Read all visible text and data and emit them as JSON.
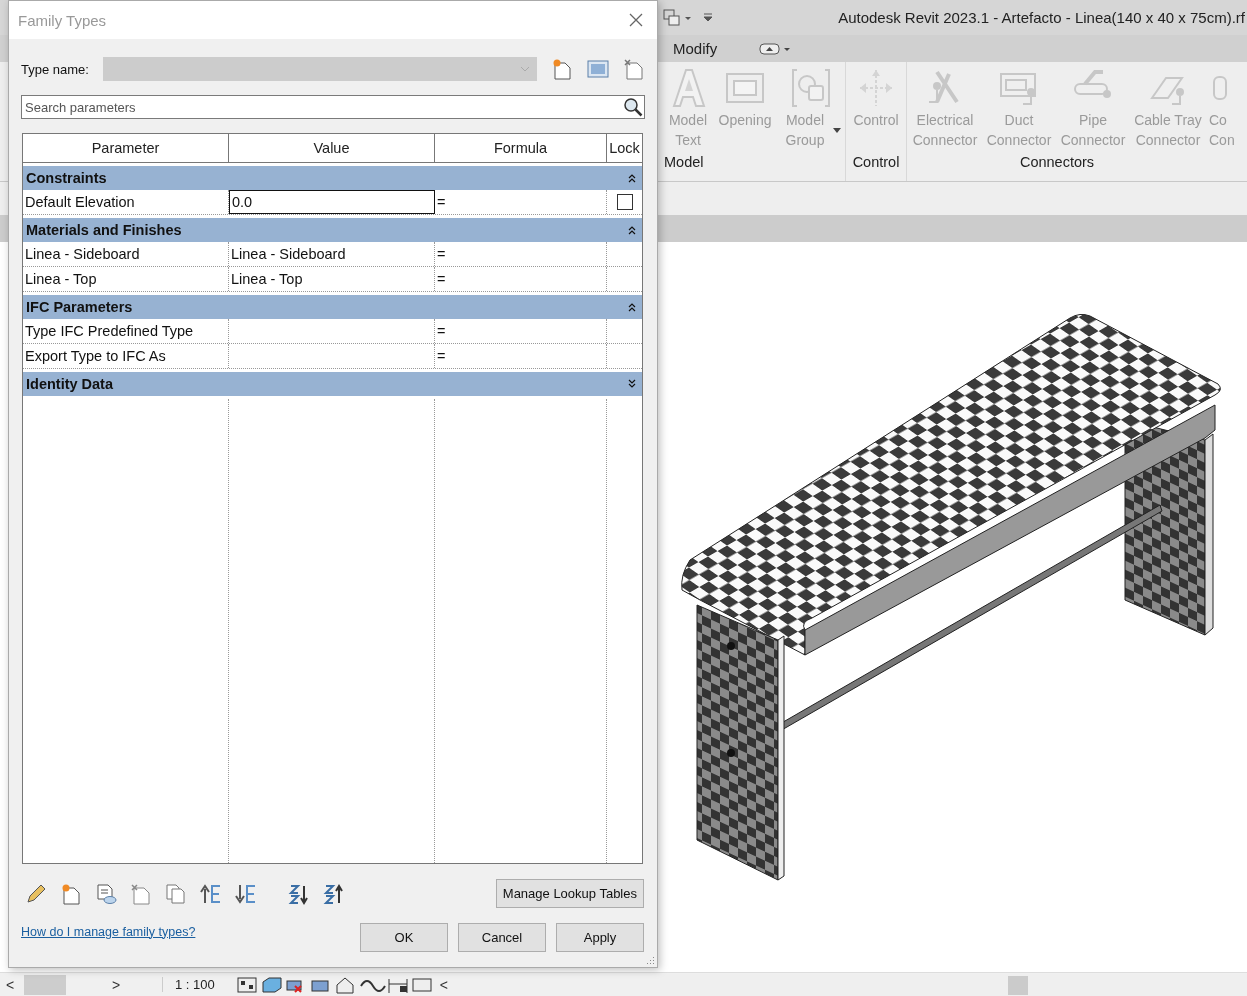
{
  "app": {
    "title": "Autodesk Revit 2023.1 - Artefacto - Linea(140 x 40 x 75cm).rf",
    "ribbon_tab": "Modify",
    "ribbon_panels": [
      {
        "label": "Model",
        "tools": [
          {
            "kind": "text",
            "label": "Model Text",
            "disabled": true
          },
          {
            "kind": "opening",
            "label": "Opening",
            "disabled": true
          },
          {
            "kind": "group",
            "label": "Model Group",
            "disabled": true
          }
        ]
      },
      {
        "label": "Control",
        "tools": [
          {
            "kind": "control",
            "label": "Control",
            "disabled": true
          }
        ]
      },
      {
        "label": "Connectors",
        "tools": [
          {
            "kind": "electrical",
            "label": "Electrical Connector",
            "disabled": true
          },
          {
            "kind": "duct",
            "label": "Duct Connector",
            "disabled": true
          },
          {
            "kind": "pipe",
            "label": "Pipe Connector",
            "disabled": true
          },
          {
            "kind": "cable_tray",
            "label": "Cable Tray Connector",
            "disabled": true
          },
          {
            "kind": "conduit",
            "label": "Co Con",
            "disabled": true
          }
        ]
      }
    ],
    "status_bar": {
      "scroll_left": "<",
      "scroll_right": ">",
      "scale": "1 : 100",
      "collapse": "<"
    }
  },
  "dialog": {
    "title": "Family Types",
    "type_name": {
      "label": "Type name:",
      "disabled": true
    },
    "search": {
      "placeholder": "Search parameters"
    },
    "columns": [
      "Parameter",
      "Value",
      "Formula",
      "Lock"
    ],
    "groups": [
      {
        "name": "Constraints",
        "expanded": true,
        "rows": [
          {
            "parameter": "Default Elevation",
            "value": "0.0",
            "formula": "=",
            "selected": true,
            "lock": false
          }
        ]
      },
      {
        "name": "Materials and Finishes",
        "expanded": true,
        "rows": [
          {
            "parameter": "Linea - Sideboard",
            "value": "Linea - Sideboard",
            "formula": "=",
            "selected": false
          },
          {
            "parameter": "Linea - Top",
            "value": "Linea - Top",
            "formula": "=",
            "selected": false
          }
        ]
      },
      {
        "name": "IFC Parameters",
        "expanded": true,
        "rows": [
          {
            "parameter": "Type IFC Predefined Type",
            "formula": "=",
            "selected": false
          },
          {
            "parameter": "Export Type to IFC As",
            "formula": "=",
            "selected": false
          }
        ]
      },
      {
        "name": "Identity Data",
        "expanded": false
      }
    ],
    "manage_button": "Manage Lookup Tables",
    "link": "How do I manage family types?",
    "buttons": [
      "OK",
      "Cancel",
      "Apply"
    ]
  }
}
